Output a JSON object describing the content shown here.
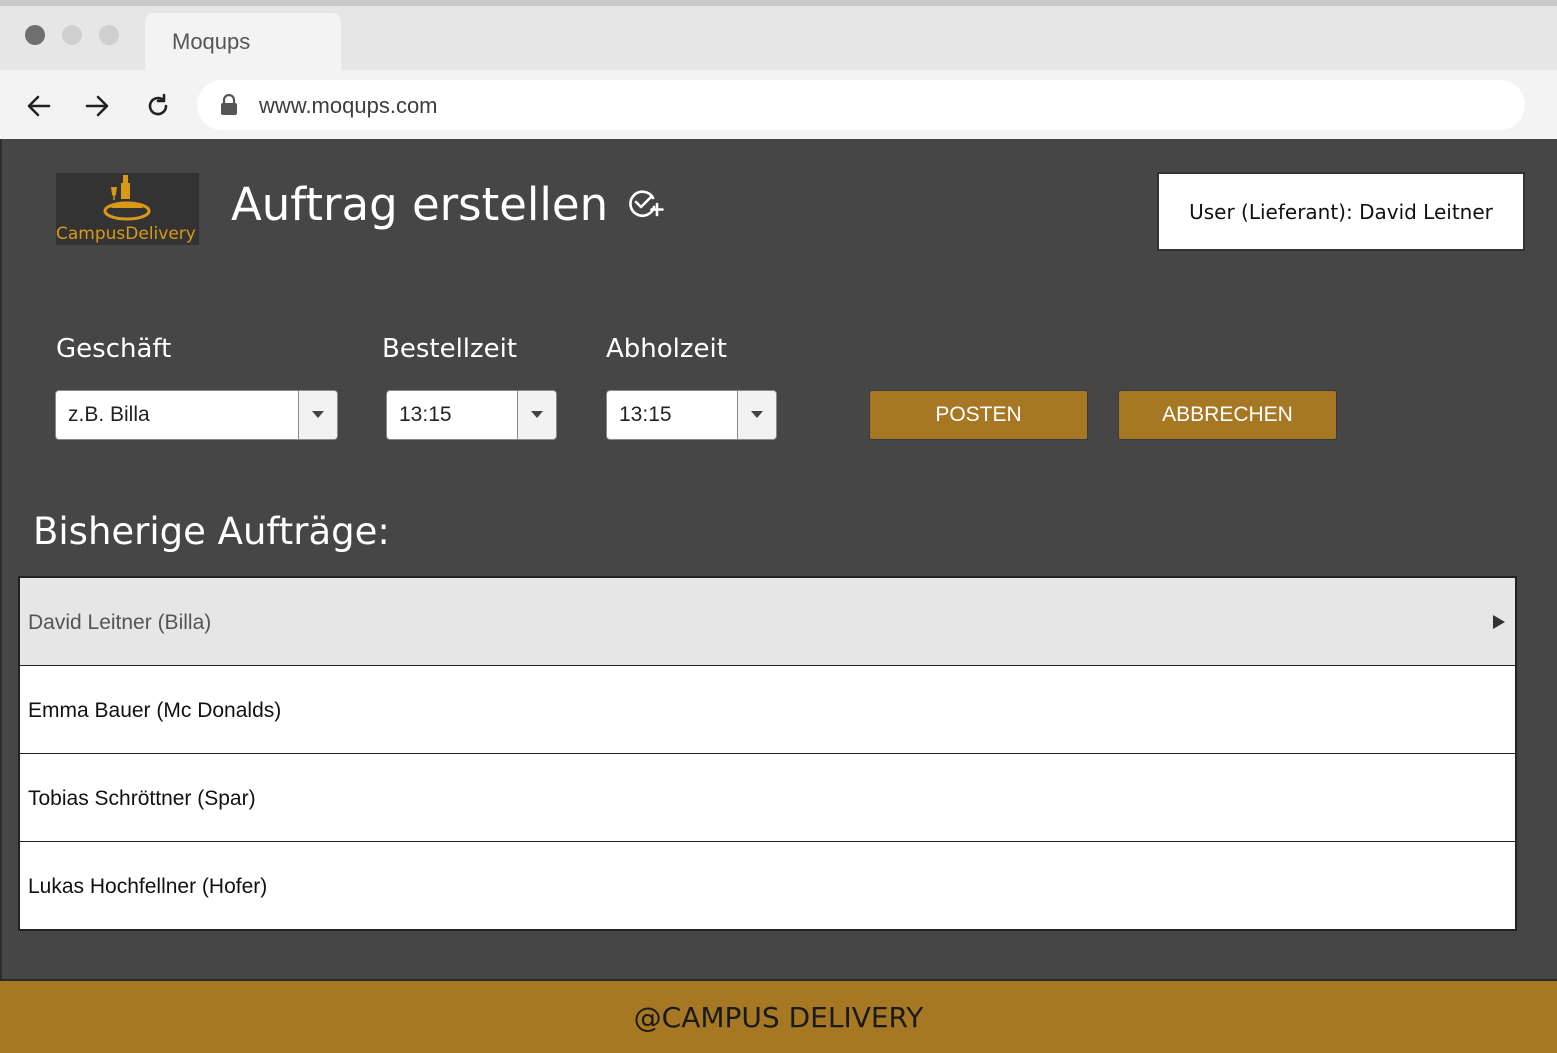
{
  "browser": {
    "tab_title": "Moqups",
    "url": "www.moqups.com"
  },
  "header": {
    "logo_text": "CampusDelivery",
    "title": "Auftrag erstellen",
    "user_label": "User (Lieferant): David Leitner"
  },
  "form": {
    "shop": {
      "label": "Geschäft",
      "value": "z.B. Billa"
    },
    "order_time": {
      "label": "Bestellzeit",
      "value": "13:15"
    },
    "pickup_time": {
      "label": "Abholzeit",
      "value": "13:15"
    },
    "post_label": "POSTEN",
    "cancel_label": "ABBRECHEN"
  },
  "orders": {
    "title": "Bisherige Aufträge:",
    "items": [
      {
        "label": "David Leitner (Billa)"
      },
      {
        "label": "Emma Bauer (Mc Donalds)"
      },
      {
        "label": "Tobias Schröttner (Spar)"
      },
      {
        "label": "Lukas Hochfellner (Hofer)"
      }
    ]
  },
  "footer": {
    "text": "@CAMPUS DELIVERY"
  },
  "colors": {
    "accent": "#a77823",
    "background": "#464646",
    "logo_gold": "#d89a16"
  }
}
